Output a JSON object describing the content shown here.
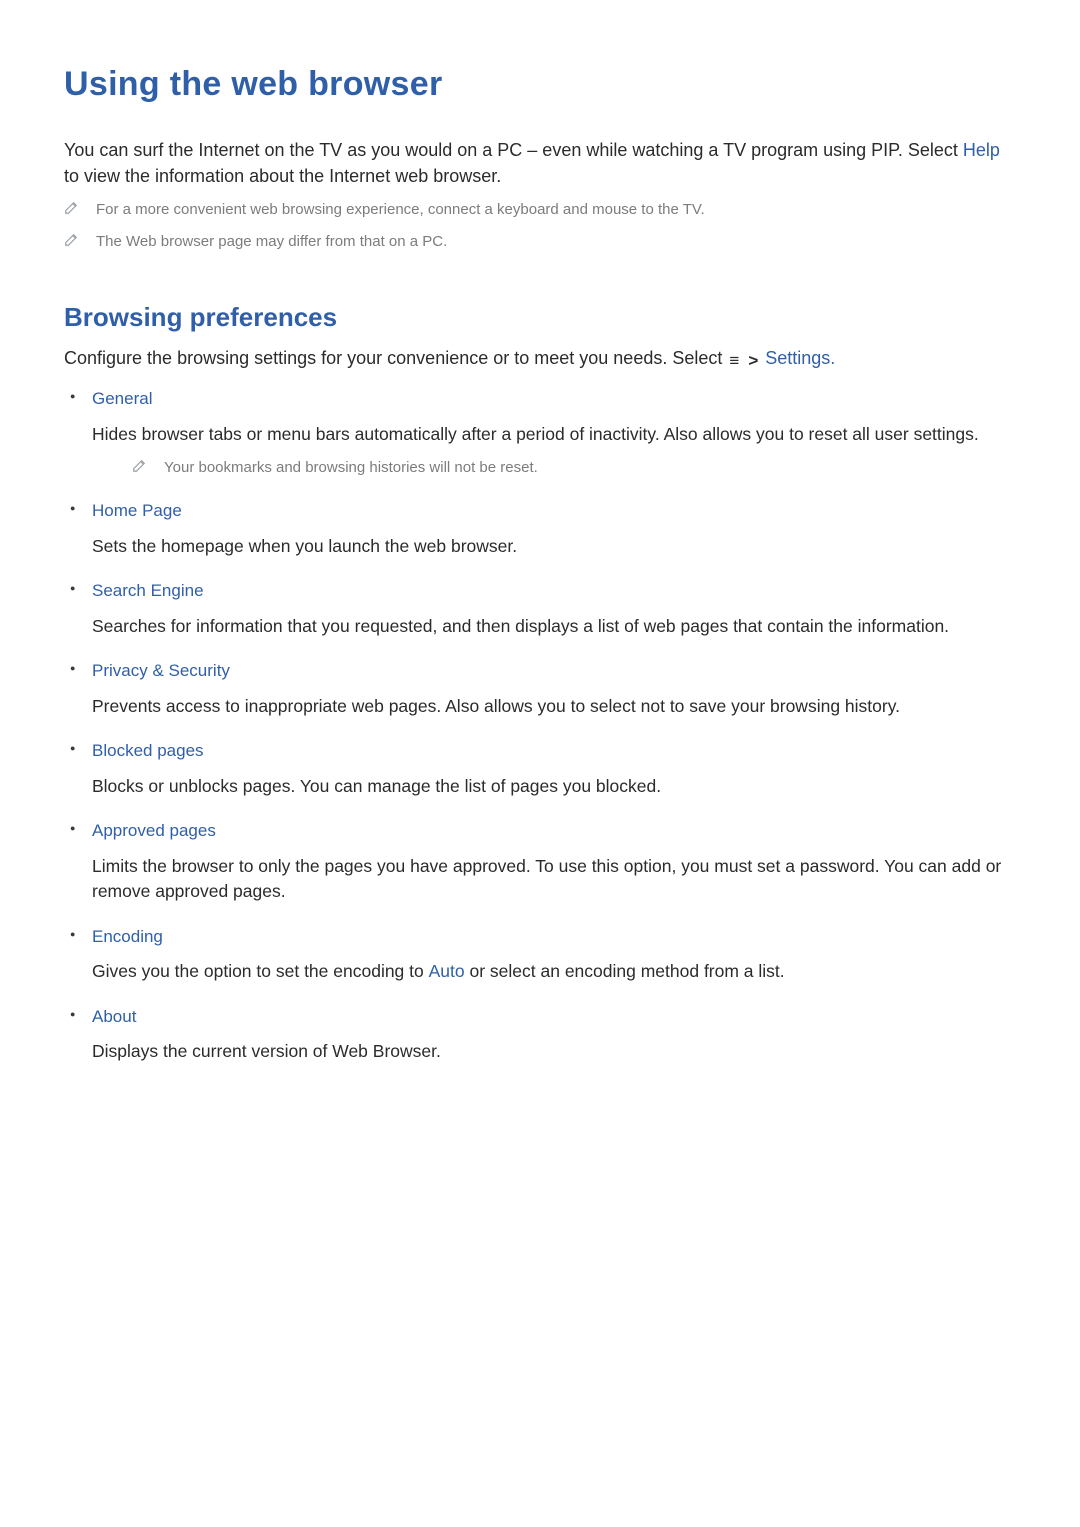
{
  "page_title": "Using the web browser",
  "intro": {
    "part1": "You can surf the Internet on the TV as you would on a PC – even while watching a TV program using PIP. Select ",
    "help_label": "Help",
    "part2": " to view the information about the Internet web browser."
  },
  "notes": {
    "note1": "For a more convenient web browsing experience, connect a keyboard and mouse to the TV.",
    "note2": "The Web browser page may differ from that on a PC."
  },
  "section_title": "Browsing preferences",
  "section_intro": {
    "part1": "Configure the browsing settings for your convenience or to meet you needs. Select ",
    "settings_label": "Settings.",
    "menu_glyph": "≡",
    "chevron_glyph": ">"
  },
  "items": [
    {
      "title": "General",
      "body": "Hides browser tabs or menu bars automatically after a period of inactivity. Also allows you to reset all user settings.",
      "note": "Your bookmarks and browsing histories will not be reset."
    },
    {
      "title": "Home Page",
      "body": "Sets the homepage when you launch the web browser."
    },
    {
      "title": "Search Engine",
      "body": "Searches for information that you requested, and then displays a list of web pages that contain the information."
    },
    {
      "title": "Privacy & Security",
      "body": "Prevents access to inappropriate web pages. Also allows you to select not to save your browsing history."
    },
    {
      "title": "Blocked pages",
      "body": "Blocks or unblocks pages. You can manage the list of pages you blocked."
    },
    {
      "title": "Approved pages",
      "body": "Limits the browser to only the pages you have approved. To use this option, you must set a password. You can add or remove approved pages."
    },
    {
      "title": "Encoding",
      "body_pre": "Gives you the option to set the encoding to ",
      "body_accent": "Auto",
      "body_post": " or select an encoding method from a list."
    },
    {
      "title": "About",
      "body": "Displays the current version of Web Browser."
    }
  ]
}
